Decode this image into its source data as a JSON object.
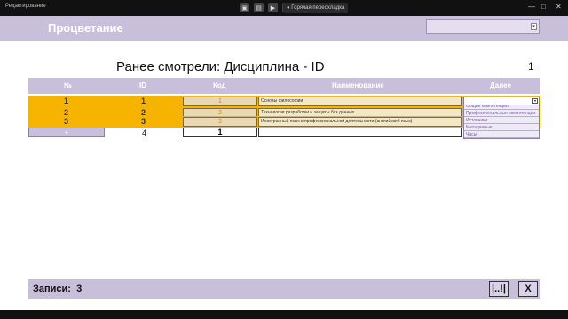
{
  "window": {
    "title": "Редактирование",
    "tab_label": "Горячая переохладка",
    "controls": {
      "minimize": "—",
      "maximize": "□",
      "close": "✕"
    }
  },
  "header": {
    "brand": "Процветание",
    "dropdown_value": ""
  },
  "heading": "Ранее смотрели: Дисциплина - ID",
  "page_number": "1",
  "table": {
    "columns": [
      "№",
      "ID",
      "Код",
      "Наименование",
      "Далее"
    ],
    "rows": [
      {
        "num": "1",
        "id": "1",
        "code": "1",
        "name": "Основы философии"
      },
      {
        "num": "2",
        "id": "2",
        "code": "2",
        "name": "Технология разработки и защиты баз данных"
      },
      {
        "num": "3",
        "id": "3",
        "code": "3",
        "name": "Иностранный язык в профессиональной деятельности (английский язык)"
      }
    ],
    "new_row": {
      "add_label": "+",
      "id": "4",
      "code": "1",
      "name": ""
    }
  },
  "next_menu": {
    "options": [
      "Общие компетенции",
      "Профессиональные компетенции",
      "Источники",
      "Метаданные",
      "Часы"
    ]
  },
  "footer": {
    "records_label": "Записи:",
    "records_count": "3",
    "export_label": "|..!|",
    "close_label": "X"
  },
  "colors": {
    "accent": "#c8bfdb",
    "row_highlight": "#f6b400"
  }
}
